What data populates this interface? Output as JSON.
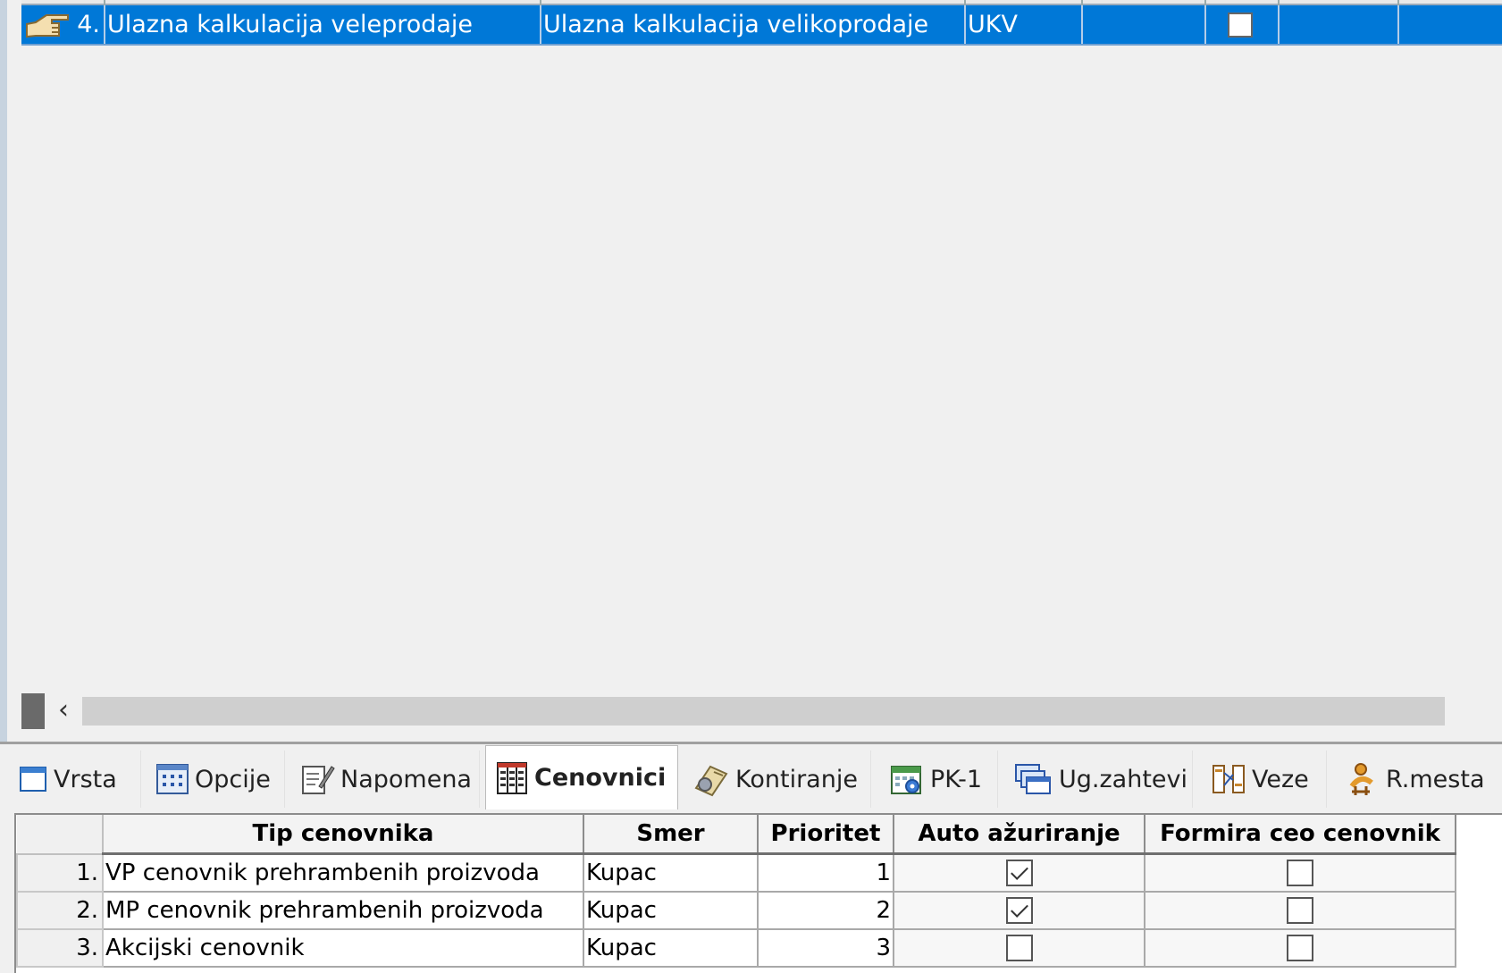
{
  "top_grid": {
    "selected_row": {
      "row_number": "4.",
      "naziv": "Ulazna kalkulacija veleprodaje",
      "opis": "Ulazna kalkulacija velikoprodaje",
      "oznaka": "UKV",
      "checkbox_checked": false
    }
  },
  "tabs": [
    {
      "label": "Vrsta",
      "icon": "window-icon",
      "active": false
    },
    {
      "label": "Opcije",
      "icon": "options-grid-icon",
      "active": false
    },
    {
      "label": "Napomena",
      "icon": "note-icon",
      "active": false
    },
    {
      "label": "Cenovnici",
      "icon": "price-list-icon",
      "active": true
    },
    {
      "label": "Kontiranje",
      "icon": "ledger-icon",
      "active": false
    },
    {
      "label": "PK-1",
      "icon": "calendar-gear-icon",
      "active": false
    },
    {
      "label": "Ug.zahtevi",
      "icon": "stacked-windows-icon",
      "active": false
    },
    {
      "label": "Veze",
      "icon": "links-icon",
      "active": false
    },
    {
      "label": "R.mesta",
      "icon": "workplace-icon",
      "active": false
    }
  ],
  "price_table": {
    "columns": [
      "Tip cenovnika",
      "Smer",
      "Prioritet",
      "Auto ažuriranje",
      "Formira ceo cenovnik"
    ],
    "rows": [
      {
        "num": "1.",
        "tip": "VP cenovnik prehrambenih proizvoda",
        "smer": "Kupac",
        "prioritet": "1",
        "auto": true,
        "formira": false
      },
      {
        "num": "2.",
        "tip": "MP cenovnik prehrambenih proizvoda",
        "smer": "Kupac",
        "prioritet": "2",
        "auto": true,
        "formira": false
      },
      {
        "num": "3.",
        "tip": "Akcijski cenovnik",
        "smer": "Kupac",
        "prioritet": "3",
        "auto": false,
        "formira": false
      }
    ]
  },
  "colors": {
    "selection": "#0078d7",
    "background": "#f0f0f0"
  }
}
